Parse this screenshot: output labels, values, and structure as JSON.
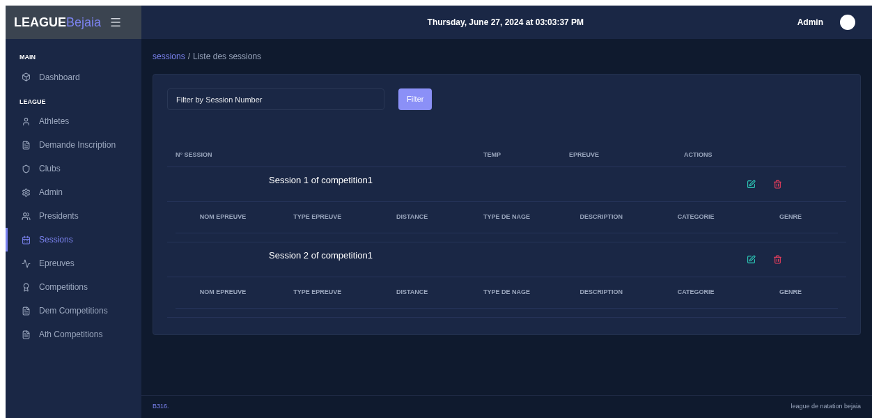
{
  "brand": {
    "bold": "LEAGUE",
    "light": "Bejaia"
  },
  "header": {
    "datetime": "Thursday, June 27, 2024 at 03:03:37 PM",
    "user": "Admin"
  },
  "sidebar": {
    "sections": [
      {
        "title": "MAIN",
        "items": [
          {
            "label": "Dashboard",
            "selected": false
          }
        ]
      },
      {
        "title": "LEAGUE",
        "items": [
          {
            "label": "Athletes",
            "selected": false
          },
          {
            "label": "Demande Inscription",
            "selected": false
          },
          {
            "label": "Clubs",
            "selected": false
          },
          {
            "label": "Admin",
            "selected": false
          },
          {
            "label": "Presidents",
            "selected": false
          },
          {
            "label": "Sessions",
            "selected": true
          },
          {
            "label": "Epreuves",
            "selected": false
          },
          {
            "label": "Competitions",
            "selected": false
          },
          {
            "label": "Dem Competitions",
            "selected": false
          },
          {
            "label": "Ath Competitions",
            "selected": false
          }
        ]
      }
    ]
  },
  "breadcrumb": {
    "link": "sessions",
    "separator": "/",
    "current": "Liste des sessions"
  },
  "filter": {
    "placeholder": "Filter by Session Number",
    "button": "Filter"
  },
  "table": {
    "columns": [
      "N° SESSION",
      "TEMP",
      "EPREUVE",
      "ACTIONS"
    ],
    "rows": [
      {
        "name": "Session 1 of competition1",
        "sub_columns": [
          "NOM EPREUVE",
          "TYPE EPREUVE",
          "DISTANCE",
          "TYPE DE NAGE",
          "DESCRIPTION",
          "CATEGORIE",
          "GENRE"
        ]
      },
      {
        "name": "Session 2 of competition1",
        "sub_columns": [
          "NOM EPREUVE",
          "TYPE EPREUVE",
          "DISTANCE",
          "TYPE DE NAGE",
          "DESCRIPTION",
          "CATEGORIE",
          "GENRE"
        ]
      }
    ]
  },
  "footer": {
    "left": "B316.",
    "right": "league de natation bejaia"
  }
}
